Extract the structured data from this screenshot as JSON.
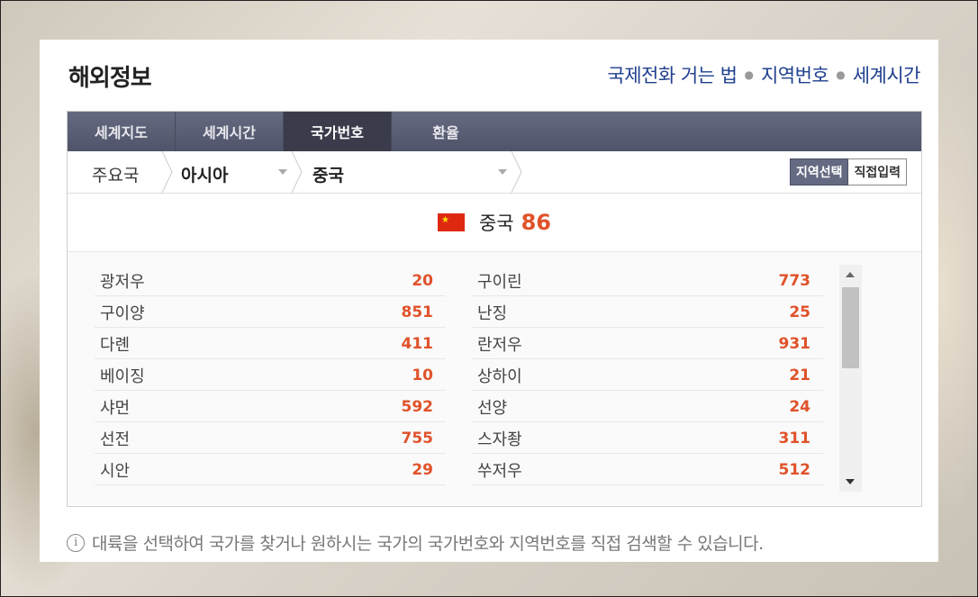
{
  "header": {
    "title": "해외정보",
    "links": [
      "국제전화 거는 법",
      "지역번호",
      "세계시간"
    ]
  },
  "tabs": [
    "세계지도",
    "세계시간",
    "국가번호",
    "환율"
  ],
  "active_tab": "국가번호",
  "breadcrumb": {
    "first": "주요국",
    "continent": "아시아",
    "country": "중국"
  },
  "mode_buttons": {
    "select": "지역선택",
    "direct": "직접입력"
  },
  "country": {
    "name": "중국",
    "code": "86",
    "flag": "china-flag"
  },
  "cities_left": [
    {
      "name": "광저우",
      "code": "20"
    },
    {
      "name": "구이양",
      "code": "851"
    },
    {
      "name": "다롄",
      "code": "411"
    },
    {
      "name": "베이징",
      "code": "10"
    },
    {
      "name": "샤먼",
      "code": "592"
    },
    {
      "name": "선전",
      "code": "755"
    },
    {
      "name": "시안",
      "code": "29"
    }
  ],
  "cities_right": [
    {
      "name": "구이린",
      "code": "773"
    },
    {
      "name": "난징",
      "code": "25"
    },
    {
      "name": "란저우",
      "code": "931"
    },
    {
      "name": "상하이",
      "code": "21"
    },
    {
      "name": "선양",
      "code": "24"
    },
    {
      "name": "스자좡",
      "code": "311"
    },
    {
      "name": "쑤저우",
      "code": "512"
    }
  ],
  "note": "대륙을 선택하여 국가를 찾거나 원하시는 국가의 국가번호와 지역번호를 직접 검색할 수 있습니다.",
  "colors": {
    "accent": "#e0522a",
    "link": "#1f3f8f",
    "tabbar": "#50546a"
  }
}
